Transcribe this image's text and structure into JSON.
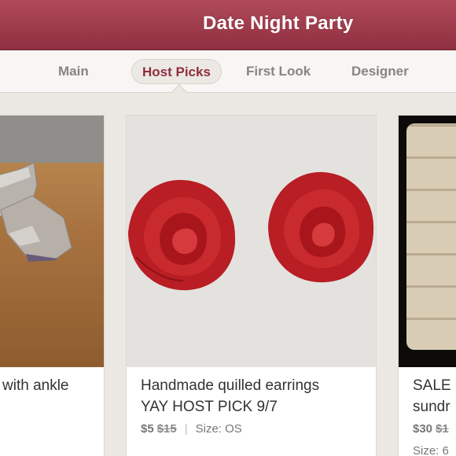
{
  "header": {
    "title": "Date Night Party"
  },
  "tabs": [
    {
      "label": "Main",
      "active": false
    },
    {
      "label": "Host Picks",
      "active": true
    },
    {
      "label": "First Look",
      "active": false
    },
    {
      "label": "Designer",
      "active": false
    }
  ],
  "listings": [
    {
      "title": "with ankle",
      "price": "",
      "original_price": "",
      "size": ""
    },
    {
      "title": "Handmade quilled earrings\nYAY HOST PICK 9/7",
      "price": "$5",
      "original_price": "$15",
      "size": "Size: OS"
    },
    {
      "title": "SALE\nsundr",
      "price": "$30",
      "original_price": "$1",
      "size": "Size: 6"
    }
  ],
  "colors": {
    "header": "#9c3a4b",
    "accent": "#8f2f3f",
    "tab_text": "#8a8480",
    "background": "#ebe7e2"
  }
}
